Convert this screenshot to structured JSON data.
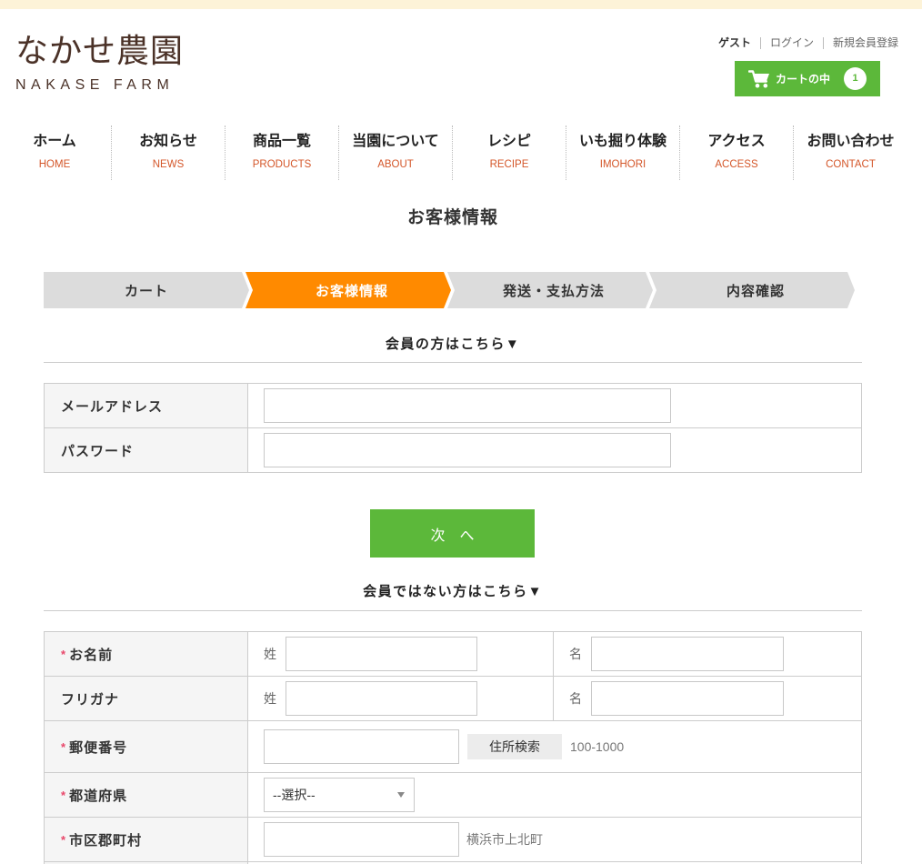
{
  "colors": {
    "top_band": "#fdf3d8",
    "brand": "#4b3228",
    "green": "#5cb83a",
    "orange": "#ff8a00",
    "nav_en": "#d4572a",
    "required": "#e8476a"
  },
  "brand": {
    "name_ja": "なかせ農園",
    "name_en": "NAKASE FARM"
  },
  "account_links": {
    "guest": "ゲスト",
    "login": "ログイン",
    "register": "新規会員登録"
  },
  "cart": {
    "icon": "cart-icon",
    "label": "カートの中",
    "count": "1"
  },
  "nav": [
    {
      "ja": "ホーム",
      "en": "HOME"
    },
    {
      "ja": "お知らせ",
      "en": "NEWS"
    },
    {
      "ja": "商品一覧",
      "en": "PRODUCTS"
    },
    {
      "ja": "当園について",
      "en": "ABOUT"
    },
    {
      "ja": "レシピ",
      "en": "RECIPE"
    },
    {
      "ja": "いも掘り体験",
      "en": "IMOHORI"
    },
    {
      "ja": "アクセス",
      "en": "ACCESS"
    },
    {
      "ja": "お問い合わせ",
      "en": "CONTACT"
    }
  ],
  "page_title": "お客様情報",
  "steps": [
    {
      "label": "カート",
      "active": false
    },
    {
      "label": "お客様情報",
      "active": true
    },
    {
      "label": "発送・支払方法",
      "active": false
    },
    {
      "label": "内容確認",
      "active": false
    }
  ],
  "member_login": {
    "heading": "会員の方はこちら▼",
    "email_label": "メールアドレス",
    "email_value": "",
    "password_label": "パスワード",
    "password_value": "",
    "next_button": "次　へ"
  },
  "guest_form": {
    "heading": "会員ではない方はこちら▼",
    "required_mark": "*",
    "name": {
      "label": "お名前",
      "required": true,
      "last_label": "姓",
      "last_value": "",
      "first_label": "名",
      "first_value": ""
    },
    "furigana": {
      "label": "フリガナ",
      "required": false,
      "last_label": "姓",
      "last_value": "",
      "first_label": "名",
      "first_value": ""
    },
    "postal": {
      "label": "郵便番号",
      "required": true,
      "value": "",
      "search_button": "住所検索",
      "example": "100-1000"
    },
    "prefecture": {
      "label": "都道府県",
      "required": true,
      "selected": "--選択--",
      "arrow_icon": "chevron-down-icon"
    },
    "city": {
      "label": "市区郡町村",
      "required": true,
      "value": "",
      "example": "横浜市上北町"
    }
  }
}
